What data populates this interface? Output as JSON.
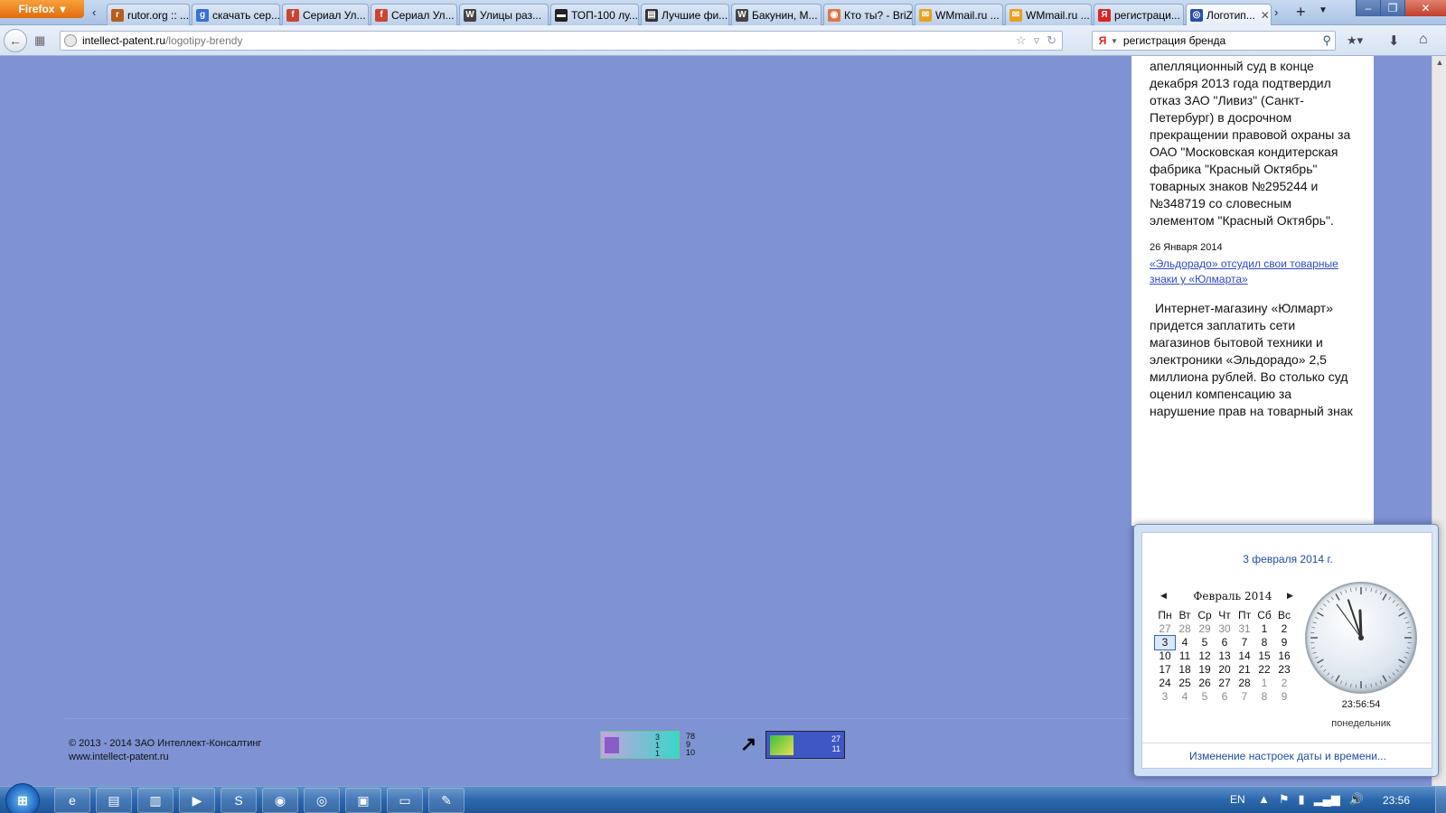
{
  "browser": {
    "menu_label": "Firefox",
    "tabs": [
      {
        "label": "rutor.org :: ...",
        "icon": "rutor-icon",
        "color": "#b85d1a"
      },
      {
        "label": "скачать сер...",
        "icon": "google-icon",
        "color": "#3b6ed8"
      },
      {
        "label": "Сериал Ул...",
        "icon": "ifile-icon",
        "color": "#c43"
      },
      {
        "label": "Сериал Ул...",
        "icon": "ifile-icon",
        "color": "#c43"
      },
      {
        "label": "Улицы раз...",
        "icon": "wikipedia-icon",
        "color": "#444"
      },
      {
        "label": "ТОП-100 лу...",
        "icon": "film-icon",
        "color": "#222"
      },
      {
        "label": "Лучшие фи...",
        "icon": "clapper-icon",
        "color": "#333"
      },
      {
        "label": "Бакунин, М...",
        "icon": "wikipedia-icon",
        "color": "#444"
      },
      {
        "label": "Кто ты? - BriZ",
        "icon": "briz-icon",
        "color": "#d74"
      },
      {
        "label": "WMmail.ru ...",
        "icon": "wmmail-icon",
        "color": "#e8a020"
      },
      {
        "label": "WMmail.ru ...",
        "icon": "wmmail-icon",
        "color": "#e8a020"
      },
      {
        "label": "регистраци...",
        "icon": "yandex-icon",
        "color": "#d22"
      },
      {
        "label": "Логотип...",
        "icon": "patent-icon",
        "color": "#2a4ea8",
        "active": true
      }
    ]
  },
  "nav": {
    "url_host": "intellect-patent.ru",
    "url_path": "/logotipy-brendy",
    "search_value": "регистрация бренда"
  },
  "article": {
    "paragraph1": "апелляционный суд в конце декабря 2013 года подтвердил отказ ЗАО \"Ливиз\" (Санкт-Петербург) в досрочном прекращении правовой охраны за ОАО \"Московская кондитерская фабрика \"Красный Октябрь\" товарных знаков №295244 и №348719 со словесным элементом \"Красный Октябрь\".",
    "news_date": "26 Января 2014",
    "news_link": "«Эльдорадо» отсудил свои товарные знаки у «Юлмарта»",
    "paragraph2": "Интернет-магазину «Юлмарт» придется заплатить сети магазинов бытовой техники и электроники «Эльдорадо» 2,5 миллиона рублей. Во столько суд оценил компенсацию за нарушение прав на товарный знак"
  },
  "footer": {
    "copyright": "© 2013 - 2014 ЗАО Интеллект-Консалтинг",
    "site": "www.intellect-patent.ru",
    "counter1": [
      "3",
      "1",
      "1"
    ],
    "counter2": [
      "78",
      "9",
      "10"
    ],
    "counter3": [
      "27",
      "11"
    ]
  },
  "calendar": {
    "date_title": "3 февраля 2014 г.",
    "month_label": "Февраль 2014",
    "weekdays": [
      "Пн",
      "Вт",
      "Ср",
      "Чт",
      "Пт",
      "Сб",
      "Вс"
    ],
    "weeks": [
      [
        {
          "d": "27",
          "m": true
        },
        {
          "d": "28",
          "m": true
        },
        {
          "d": "29",
          "m": true
        },
        {
          "d": "30",
          "m": true
        },
        {
          "d": "31",
          "m": true
        },
        {
          "d": "1"
        },
        {
          "d": "2"
        }
      ],
      [
        {
          "d": "3",
          "today": true
        },
        {
          "d": "4"
        },
        {
          "d": "5"
        },
        {
          "d": "6"
        },
        {
          "d": "7"
        },
        {
          "d": "8"
        },
        {
          "d": "9"
        }
      ],
      [
        {
          "d": "10"
        },
        {
          "d": "11"
        },
        {
          "d": "12"
        },
        {
          "d": "13"
        },
        {
          "d": "14"
        },
        {
          "d": "15"
        },
        {
          "d": "16"
        }
      ],
      [
        {
          "d": "17"
        },
        {
          "d": "18"
        },
        {
          "d": "19"
        },
        {
          "d": "20"
        },
        {
          "d": "21"
        },
        {
          "d": "22"
        },
        {
          "d": "23"
        }
      ],
      [
        {
          "d": "24"
        },
        {
          "d": "25"
        },
        {
          "d": "26"
        },
        {
          "d": "27"
        },
        {
          "d": "28"
        },
        {
          "d": "1",
          "m": true
        },
        {
          "d": "2",
          "m": true
        }
      ],
      [
        {
          "d": "3",
          "m": true
        },
        {
          "d": "4",
          "m": true
        },
        {
          "d": "5",
          "m": true
        },
        {
          "d": "6",
          "m": true
        },
        {
          "d": "7",
          "m": true
        },
        {
          "d": "8",
          "m": true
        },
        {
          "d": "9",
          "m": true
        }
      ]
    ],
    "clock_time": "23:56:54",
    "clock_day": "понедельник",
    "settings_link": "Изменение настроек даты и времени..."
  },
  "taskbar": {
    "apps": [
      "ie-icon",
      "explorer-icon",
      "winrar-icon",
      "media-player-icon",
      "skype-icon",
      "firefox-icon",
      "chrome-icon",
      "green-app-icon",
      "notepad-icon",
      "paint-icon"
    ],
    "lang": "EN",
    "time": "23:56"
  }
}
